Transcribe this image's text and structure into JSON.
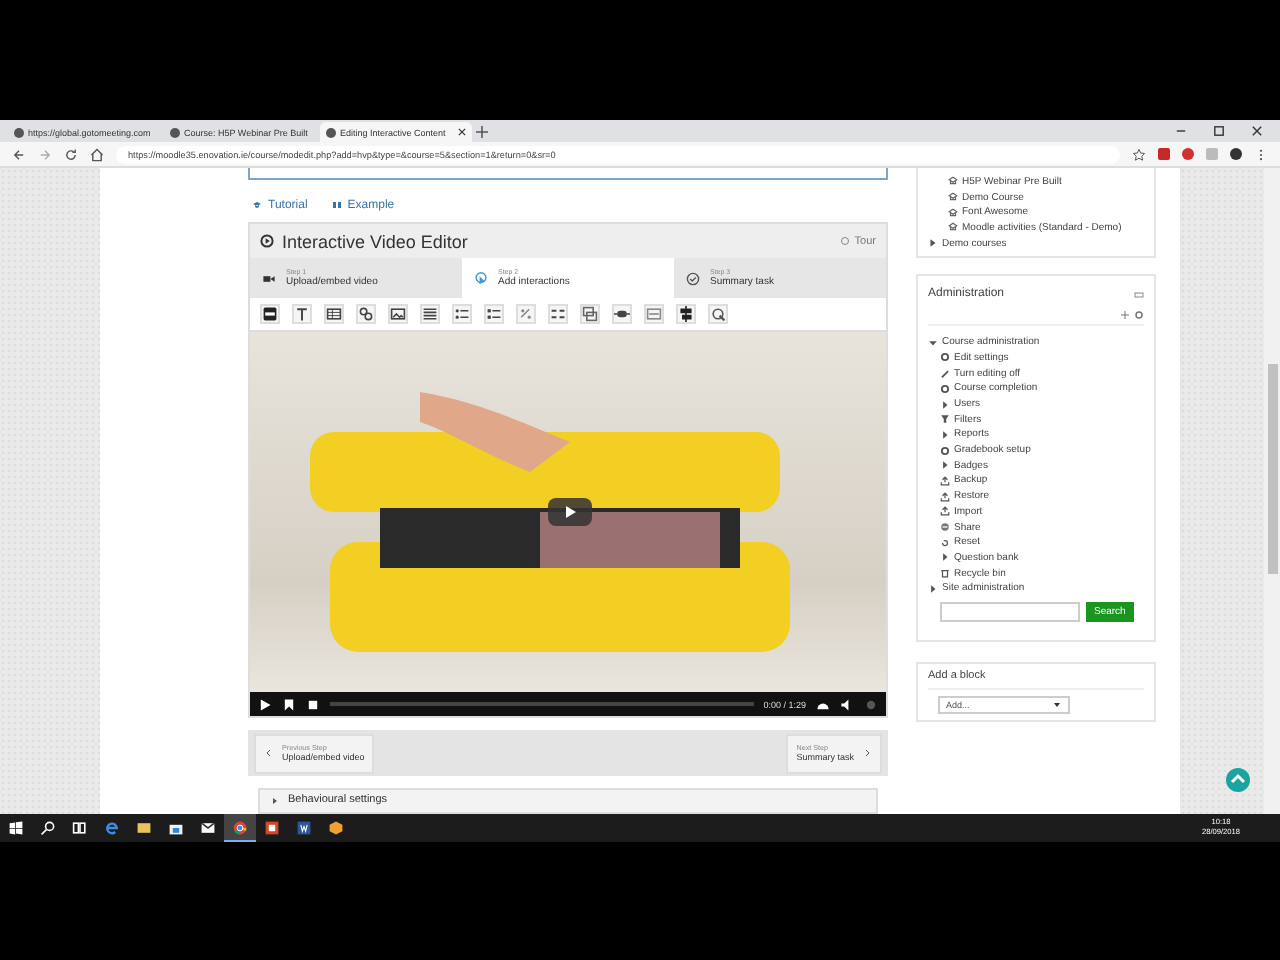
{
  "browser": {
    "tabs": [
      {
        "title": "https://global.gotomeeting.com",
        "selected": false
      },
      {
        "title": "Course: H5P Webinar Pre Built",
        "selected": false
      },
      {
        "title": "Editing Interactive Content",
        "selected": true
      }
    ],
    "url": "https://moodle35.enovation.ie/course/modedit.php?add=hvp&type=&course=5&section=1&return=0&sr=0"
  },
  "main": {
    "links": [
      {
        "kind": "tutorial",
        "label": "Tutorial"
      },
      {
        "kind": "example",
        "label": "Example"
      }
    ],
    "editor": {
      "title": "Interactive Video Editor",
      "tour": "Tour",
      "steps": [
        {
          "kind": "video",
          "step": "Step 1",
          "label": "Upload/embed video",
          "selected": false
        },
        {
          "kind": "interactions",
          "step": "Step 2",
          "label": "Add interactions",
          "selected": true
        },
        {
          "kind": "summary",
          "step": "Step 3",
          "label": "Summary task",
          "selected": false
        }
      ],
      "toolbar": [
        {
          "kind": "label"
        },
        {
          "kind": "text"
        },
        {
          "kind": "table"
        },
        {
          "kind": "link"
        },
        {
          "kind": "image"
        },
        {
          "kind": "statements"
        },
        {
          "kind": "single-choice"
        },
        {
          "kind": "multi-choice"
        },
        {
          "kind": "blanks"
        },
        {
          "kind": "drag-drop"
        },
        {
          "kind": "mark-words"
        },
        {
          "kind": "drag-text"
        },
        {
          "kind": "crossroads"
        },
        {
          "kind": "hotspot"
        },
        {
          "kind": "goto"
        }
      ],
      "player": {
        "time": "0:00 / 1:29"
      },
      "previous": {
        "caption": "Previous Step",
        "label": "Upload/embed video"
      },
      "next": {
        "caption": "Next Step",
        "label": "Summary task"
      },
      "settings": "Behavioural settings"
    }
  },
  "sidebar": {
    "courses": [
      {
        "kind": "course",
        "label": "H5P Webinar Pre Built"
      },
      {
        "kind": "course",
        "label": "Demo Course"
      },
      {
        "kind": "course",
        "label": "Font Awesome"
      },
      {
        "kind": "course",
        "label": "Moodle activities (Standard - Demo)"
      },
      {
        "kind": "category",
        "label": "Demo courses"
      }
    ],
    "administration": {
      "title": "Administration",
      "tree": [
        {
          "kind": "branch",
          "label": "Course administration",
          "expanded": true,
          "children": [
            {
              "kind": "setting",
              "label": "Edit settings"
            },
            {
              "kind": "edit",
              "label": "Turn editing off"
            },
            {
              "kind": "setting",
              "label": "Course completion"
            },
            {
              "kind": "branch",
              "label": "Users",
              "expanded": false
            },
            {
              "kind": "filter",
              "label": "Filters"
            },
            {
              "kind": "branch",
              "label": "Reports",
              "expanded": false
            },
            {
              "kind": "setting",
              "label": "Gradebook setup"
            },
            {
              "kind": "branch",
              "label": "Badges",
              "expanded": false
            },
            {
              "kind": "upload",
              "label": "Backup"
            },
            {
              "kind": "upload",
              "label": "Restore"
            },
            {
              "kind": "upload",
              "label": "Import"
            },
            {
              "kind": "share",
              "label": "Share"
            },
            {
              "kind": "reset",
              "label": "Reset"
            },
            {
              "kind": "branch",
              "label": "Question bank",
              "expanded": false
            },
            {
              "kind": "bin",
              "label": "Recycle bin"
            }
          ]
        },
        {
          "kind": "branch",
          "label": "Site administration",
          "expanded": false
        }
      ],
      "search_button": "Search"
    },
    "add_block": {
      "title": "Add a block",
      "select": "Add..."
    }
  },
  "taskbar": {
    "apps": [
      {
        "kind": "browser-e",
        "selected": false
      },
      {
        "kind": "folder",
        "selected": false
      },
      {
        "kind": "store",
        "selected": false
      },
      {
        "kind": "mail",
        "selected": false
      },
      {
        "kind": "chrome",
        "selected": true
      },
      {
        "kind": "slides",
        "selected": false
      },
      {
        "kind": "doc",
        "selected": false
      },
      {
        "kind": "box",
        "selected": false
      }
    ],
    "time": "10:18",
    "date": "28/09/2018"
  }
}
